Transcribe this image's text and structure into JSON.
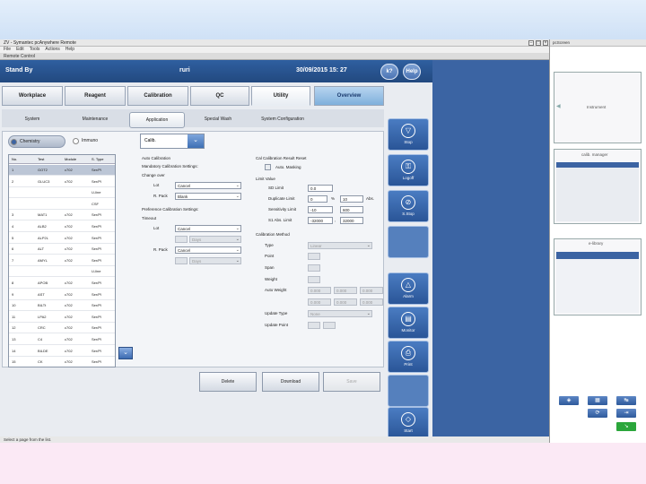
{
  "window": {
    "title": "ZV - Symantec pcAnywhere Remote",
    "menu": [
      "File",
      "Edit",
      "Tools",
      "Actions",
      "Help"
    ],
    "subtitle": "Remote Control"
  },
  "header": {
    "status": "Stand By",
    "user": "ruri",
    "datetime": "30/09/2015  15: 27",
    "help_label": "k?",
    "help2_label": "Help"
  },
  "tabs_main": [
    {
      "label": "Workplace"
    },
    {
      "label": "Reagent"
    },
    {
      "label": "Calibration"
    },
    {
      "label": "QC"
    },
    {
      "label": "Utility"
    },
    {
      "label": "Overview"
    }
  ],
  "tabs_sub": [
    {
      "label": "System"
    },
    {
      "label": "Maintenance"
    },
    {
      "label": "Application"
    },
    {
      "label": "Special Wash"
    },
    {
      "label": "System Configuration"
    }
  ],
  "radios": {
    "chemistry": "Chemistry",
    "immuno": "Immuno"
  },
  "dropdown": {
    "value": "Calib."
  },
  "table": {
    "headers": [
      "No.",
      "Test",
      "Module",
      "S. Type"
    ],
    "rows": [
      [
        "1",
        "GOT2",
        "c702",
        "Ser/Pl"
      ],
      [
        "2",
        "GLUC3",
        "c702",
        "Ser/Pl"
      ],
      [
        "",
        "",
        "",
        "U-line"
      ],
      [
        "",
        "",
        "",
        "CSF"
      ],
      [
        "3",
        "MAT1",
        "c702",
        "Ser/Pl"
      ],
      [
        "4",
        "ALB2",
        "c702",
        "Ser/Pl"
      ],
      [
        "5",
        "ALP2L",
        "c702",
        "Ser/Pl"
      ],
      [
        "6",
        "ALT",
        "c702",
        "Ser/Pl"
      ],
      [
        "7",
        "AMYL",
        "c702",
        "Ser/Pl"
      ],
      [
        "",
        "",
        "",
        "U-line"
      ],
      [
        "8",
        "APOB",
        "c702",
        "Ser/Pl"
      ],
      [
        "9",
        "AST",
        "c702",
        "Ser/Pl"
      ],
      [
        "10",
        "BILTt",
        "c702",
        "Ser/Pl"
      ],
      [
        "11",
        "LPA2",
        "c702",
        "Ser/Pl"
      ],
      [
        "12",
        "CRC",
        "c702",
        "Ser/Pl"
      ],
      [
        "13",
        "C4",
        "c702",
        "Ser/Pl"
      ],
      [
        "14",
        "BILDE",
        "c702",
        "Ser/Pl"
      ],
      [
        "15",
        "CK",
        "c702",
        "Ser/Pl"
      ]
    ]
  },
  "form": {
    "auto_cal": "Auto Calibration",
    "mand_cal": "Mandatory Calibration Settings:",
    "change_over": "Change over",
    "lot": "Lot",
    "r_pack": "R. Pack",
    "lot_val": "Cancel",
    "rpack_val": "Blank",
    "pref_cal": "Preference Calibration Settings:",
    "timeout": "Timeout",
    "lot2": "Lot",
    "rpack2": "R. Pack",
    "lot2_val": "Cancel",
    "rpack2_val": "Cancel",
    "days": "Days",
    "cal_result": "Cal Calibration Result Reset",
    "auto_masking": "Auto. Masking",
    "limit_value": "Limit Value",
    "sd_limit": "SD Limit",
    "sd_val": "0.0",
    "dup_limit": "Duplicate Limit",
    "dup_val": "0",
    "pct": "%",
    "dup_abs": "10",
    "abs": "Abs.",
    "sens_limit": "Sensitivity Limit",
    "sens_lo": "-10",
    "sens_hi": "600",
    "s1_limit": "S1 Abs. Limit",
    "s1_lo": "-32000",
    "s1_hi": "32000",
    "cal_method": "Calibration Method",
    "type": "Type",
    "type_val": "Linear",
    "point": "Point",
    "span": "Span",
    "weight": "Weight",
    "auto_weight": "Auto Weight",
    "aw_vals": [
      "0.000",
      "0.000",
      "0.000",
      "0.000",
      "0.000",
      "0.000"
    ],
    "update_type": "Update Type",
    "update_val": "None",
    "update_point": "Update Point"
  },
  "buttons": {
    "delete": "Delete",
    "download": "Download",
    "save": "Save"
  },
  "right": [
    "Stop",
    "Logoff",
    "S.Stop",
    "",
    "Alarm",
    "Monitor",
    "Print",
    "",
    "Start"
  ],
  "statusbar": "Select a page from the list.",
  "side": {
    "header": "pcScreen",
    "cap1": "Instrument",
    "cap2": "calib. manager",
    "cap3": "e-library"
  }
}
